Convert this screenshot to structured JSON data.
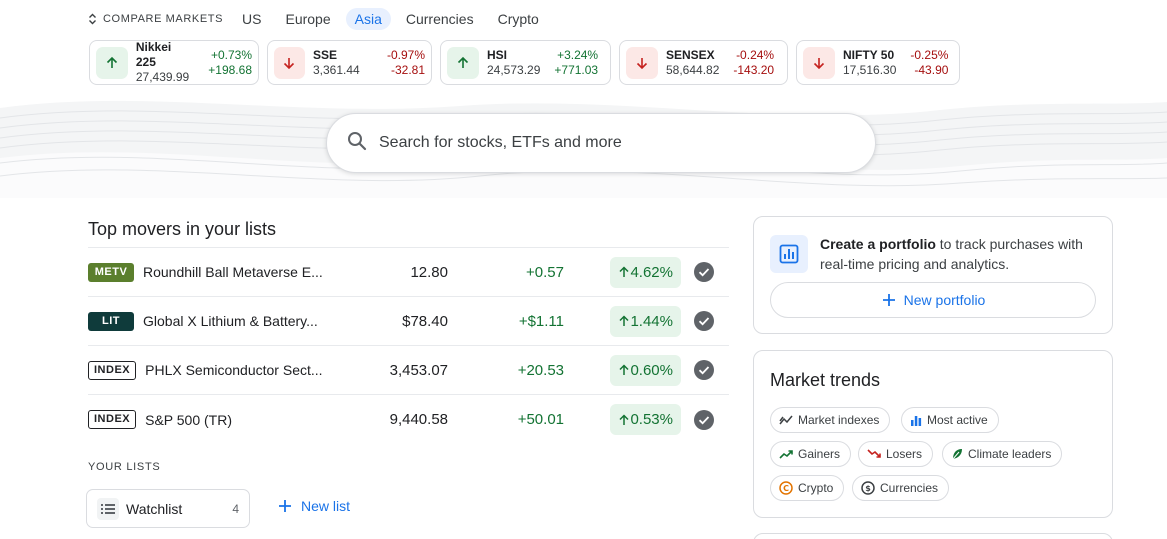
{
  "compare": {
    "label": "COMPARE MARKETS",
    "tabs": [
      {
        "label": "US",
        "active": false
      },
      {
        "label": "Europe",
        "active": false
      },
      {
        "label": "Asia",
        "active": true
      },
      {
        "label": "Currencies",
        "active": false
      },
      {
        "label": "Crypto",
        "active": false
      }
    ]
  },
  "indices": [
    {
      "name": "Nikkei 225",
      "value": "27,439.99",
      "pct": "+0.73%",
      "change": "+198.68",
      "direction": "up"
    },
    {
      "name": "SSE",
      "value": "3,361.44",
      "pct": "-0.97%",
      "change": "-32.81",
      "direction": "down"
    },
    {
      "name": "HSI",
      "value": "24,573.29",
      "pct": "+3.24%",
      "change": "+771.03",
      "direction": "up"
    },
    {
      "name": "SENSEX",
      "value": "58,644.82",
      "pct": "-0.24%",
      "change": "-143.20",
      "direction": "down"
    },
    {
      "name": "NIFTY 50",
      "value": "17,516.30",
      "pct": "-0.25%",
      "change": "-43.90",
      "direction": "down"
    }
  ],
  "search": {
    "placeholder": "Search for stocks, ETFs and more"
  },
  "movers": {
    "title": "Top movers in your lists",
    "rows": [
      {
        "ticker": "METV",
        "ticker_style": "olive",
        "name": "Roundhill Ball Metaverse E...",
        "price": "12.80",
        "change": "+0.57",
        "pct": "4.62%"
      },
      {
        "ticker": "LIT",
        "ticker_style": "dark",
        "name": "Global X Lithium & Battery...",
        "price": "$78.40",
        "change": "+$1.11",
        "pct": "1.44%"
      },
      {
        "ticker": "INDEX",
        "ticker_style": "outline",
        "name": "PHLX Semiconductor Sect...",
        "price": "3,453.07",
        "change": "+20.53",
        "pct": "0.60%"
      },
      {
        "ticker": "INDEX",
        "ticker_style": "outline",
        "name": "S&P 500 (TR)",
        "price": "9,440.58",
        "change": "+50.01",
        "pct": "0.53%"
      }
    ]
  },
  "lists": {
    "label": "YOUR LISTS",
    "watchlist_name": "Watchlist",
    "watchlist_count": "4",
    "new_list_label": "New list"
  },
  "portfolio": {
    "bold": "Create a portfolio",
    "text": " to track purchases with real-time pricing and analytics.",
    "button": "New portfolio"
  },
  "trends": {
    "title": "Market trends",
    "chips": [
      {
        "label": "Market indexes",
        "icon": "trend-line-icon"
      },
      {
        "label": "Most active",
        "icon": "bar-chart-icon"
      },
      {
        "label": "Gainers",
        "icon": "trending-up-icon"
      },
      {
        "label": "Losers",
        "icon": "trending-down-icon"
      },
      {
        "label": "Climate leaders",
        "icon": "leaf-icon"
      },
      {
        "label": "Crypto",
        "icon": "crypto-coin-icon"
      },
      {
        "label": "Currencies",
        "icon": "currency-coin-icon"
      }
    ]
  },
  "colors": {
    "accent": "#1a73e8",
    "positive": "#137333",
    "negative": "#a50e0e",
    "positive_bg": "#e6f4ea",
    "negative_bg": "#fce8e6"
  }
}
